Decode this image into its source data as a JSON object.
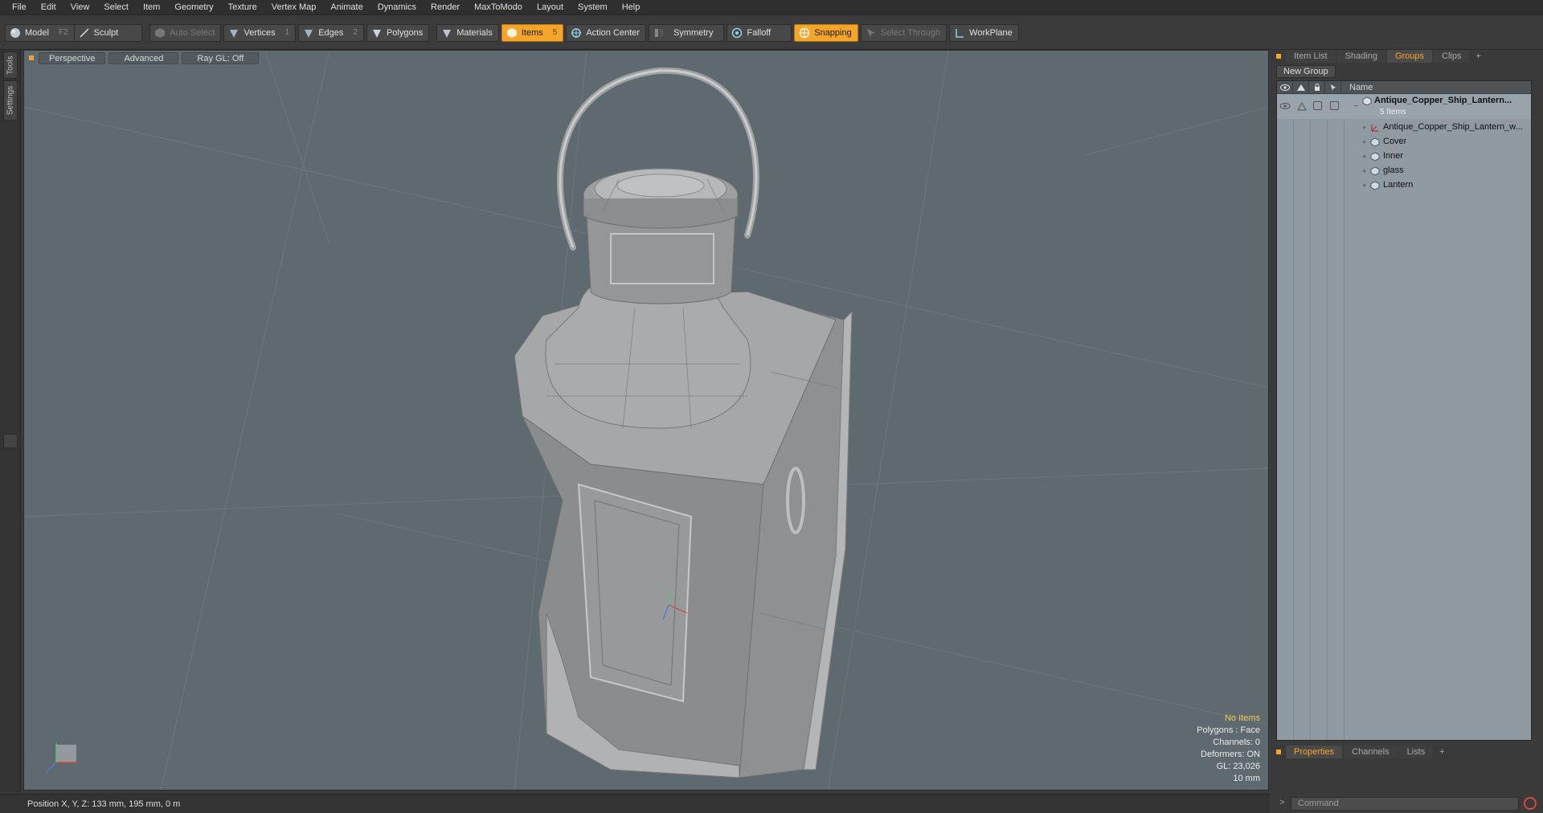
{
  "menubar": {
    "items": [
      "File",
      "Edit",
      "View",
      "Select",
      "Item",
      "Geometry",
      "Texture",
      "Vertex Map",
      "Animate",
      "Dynamics",
      "Render",
      "MaxToModo",
      "Layout",
      "System",
      "Help"
    ]
  },
  "toolbar": {
    "model": "Model",
    "model_key": "F2",
    "sculpt": "Sculpt",
    "auto_select": "Auto Select",
    "vertices": "Vertices",
    "vertices_key": "1",
    "edges": "Edges",
    "edges_key": "2",
    "polygons": "Polygons",
    "materials": "Materials",
    "items": "Items",
    "items_key": "5",
    "action_center": "Action Center",
    "symmetry": "Symmetry",
    "falloff": "Falloff",
    "snapping": "Snapping",
    "select_through": "Select Through",
    "workplane": "WorkPlane"
  },
  "left_tabs": [
    "Tools",
    "Settings"
  ],
  "viewport": {
    "view": "Perspective",
    "advanced": "Advanced",
    "raygl": "Ray GL: Off",
    "info": {
      "no_items": "No Items",
      "polygons": "Polygons : Face",
      "channels": "Channels: 0",
      "deformers": "Deformers: ON",
      "gl": "GL: 23,026",
      "scale": "10 mm"
    }
  },
  "statusbar": {
    "position": "Position X, Y, Z:   133 mm, 195 mm, 0 m"
  },
  "right_panel": {
    "tabs": [
      "Item List",
      "Shading",
      "Groups",
      "Clips"
    ],
    "active_tab": "Groups",
    "new_group": "New Group",
    "name_header": "Name",
    "group_name": "Antique_Copper_Ship_Lantern...",
    "group_count": "5 Items",
    "items": [
      "Antique_Copper_Ship_Lantern_w...",
      "Cover",
      "Inner",
      "glass",
      "Lantern"
    ],
    "bottom_tabs": [
      "Properties",
      "Channels",
      "Lists"
    ],
    "command_placeholder": "Command",
    "prompt": ">"
  },
  "colors": {
    "accent": "#f4a52a",
    "viewport_bg": "#5f6a70",
    "tree_bg": "#8f9aa3"
  }
}
